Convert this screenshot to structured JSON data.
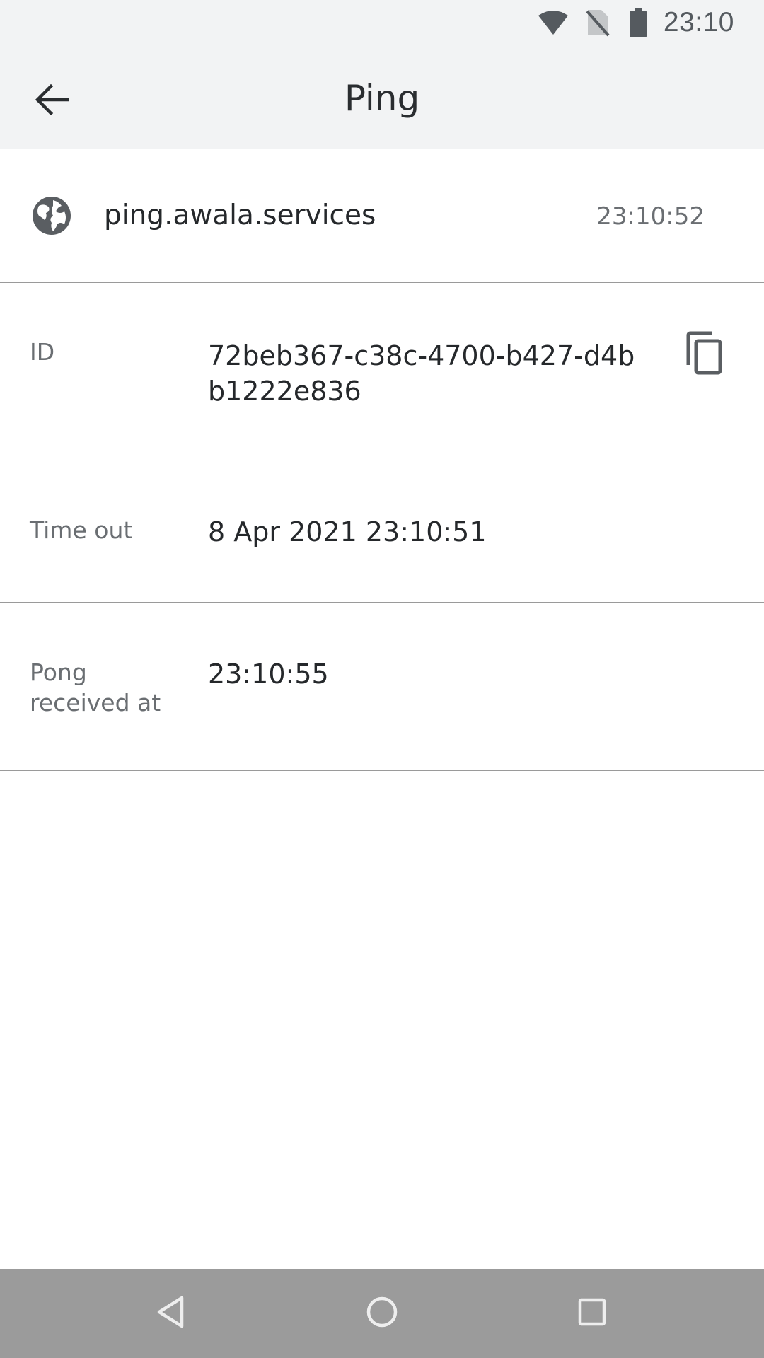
{
  "status_bar": {
    "time": "23:10",
    "icons": [
      "wifi-icon",
      "no-sim-icon",
      "battery-icon"
    ]
  },
  "toolbar": {
    "title": "Ping",
    "back_icon": "arrow-back-icon"
  },
  "endpoint": {
    "icon": "globe-icon",
    "name": "ping.awala.services",
    "time": "23:10:52"
  },
  "details": {
    "id": {
      "label": "ID",
      "value": "72beb367-c38c-4700-b427-d4bb1222e836",
      "copy_icon": "copy-icon"
    },
    "timeout": {
      "label": "Time out",
      "value": "8 Apr 2021 23:10:51"
    },
    "pong": {
      "label": "Pong received at",
      "value": "23:10:55"
    }
  },
  "nav_bar": {
    "icons": [
      "nav-back-icon",
      "nav-home-icon",
      "nav-recents-icon"
    ]
  },
  "colors": {
    "toolbar_background": "#f2f3f4",
    "nav_bar_background": "#9b9b9b",
    "divider": "#9a9a9a",
    "primary_text": "#25282b",
    "secondary_text": "#6a6e72"
  }
}
